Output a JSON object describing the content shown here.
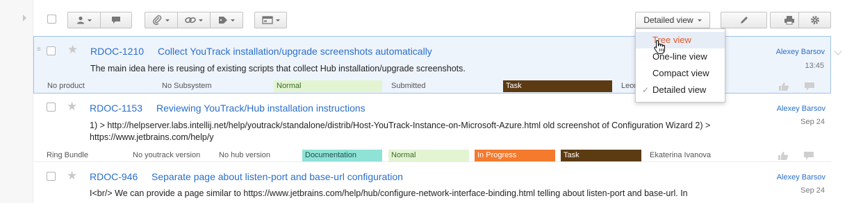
{
  "toolbar": {
    "view_button_label": "Detailed view"
  },
  "view_menu": {
    "items": [
      {
        "label": "Tree view"
      },
      {
        "label": "One-line view"
      },
      {
        "label": "Compact view"
      },
      {
        "label": "Detailed view",
        "checked": true
      }
    ]
  },
  "issues": [
    {
      "id": "RDOC-1210",
      "summary": "Collect YouTrack installation/upgrade screenshots automatically",
      "description": "The main idea here is reusing of existing scripts that collect Hub installation/upgrade screenshots.",
      "author": "Alexey Barsov",
      "date": "13:45",
      "fields": {
        "product": "No product",
        "subsystem": "No Subsystem",
        "priority": "Normal",
        "state": "Submitted",
        "type": "Task",
        "assignee": "Leon"
      }
    },
    {
      "id": "RDOC-1153",
      "summary": "Reviewing YouTrack/Hub installation instructions",
      "description_line1": "1) > http://helpserver.labs.intellij.net/help/youtrack/standalone/distrib/Host-YouTrack-Instance-on-Microsoft-Azure.html old screenshot of Configuration Wizard 2) >",
      "description_line2": "https://www.jetbrains.com/help/y",
      "author": "Alexey Barsov",
      "date": "Sep 24",
      "fields": {
        "product": "Ring Bundle",
        "youtrack_version": "No youtrack version",
        "hub_version": "No hub version",
        "subsystem": "Documentation",
        "priority": "Normal",
        "state": "In Progress",
        "type": "Task",
        "assignee": "Ekaterina Ivanova"
      }
    },
    {
      "id": "RDOC-946",
      "summary": "Separate page about listen-port and base-url configuration",
      "description": "I<br/> We can provide a page similar to https://www.jetbrains.com/help/hub/configure-network-interface-binding.html telling about listen-port and base-url. In",
      "author": "Alexey Barsov",
      "date": "Sep 24"
    }
  ],
  "colors": {
    "link": "#2a6fc9",
    "priority_normal": "#e3f4d3",
    "type_task": "#5c3a12",
    "subsystem_documentation": "#8ee2d6",
    "state_in_progress": "#f47a2e",
    "menu_hover_text": "#e05a2b",
    "selected_row_bg": "#eef4fc"
  },
  "icons": [
    "user-icon",
    "comment-icon",
    "attachment-icon",
    "link-icon",
    "tag-icon",
    "panel-icon",
    "edit-icon",
    "print-icon",
    "settings-icon",
    "star-icon",
    "thumbs-up-icon",
    "reply-icon",
    "hand-cursor-icon"
  ]
}
